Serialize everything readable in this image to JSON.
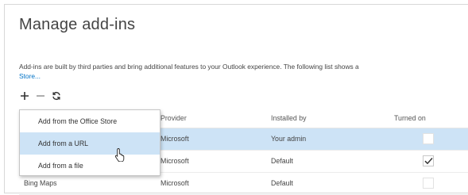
{
  "page": {
    "title": "Manage add-ins",
    "description": "Add-ins are built by third parties and bring additional features to your Outlook experience. The following list shows a",
    "description_link": "Store..."
  },
  "toolbar": {
    "icons": [
      "plus-icon",
      "minus-icon",
      "refresh-icon"
    ]
  },
  "table": {
    "columns": [
      "Provider",
      "Installed by",
      "Turned on"
    ],
    "rows": [
      {
        "name": "",
        "provider": "Microsoft",
        "installed_by": "Your admin",
        "turned_on": false,
        "selected": true
      },
      {
        "name": "",
        "provider": "Microsoft",
        "installed_by": "Default",
        "turned_on": true,
        "selected": false
      },
      {
        "name": "Bing Maps",
        "provider": "Microsoft",
        "installed_by": "Default",
        "turned_on": false,
        "selected": false
      }
    ]
  },
  "add_menu": {
    "items": [
      "Add from the Office Store",
      "Add from a URL",
      "Add from a file"
    ],
    "hovered_index": 1
  },
  "colors": {
    "accent": "#0072c6",
    "selection": "#cde3f6"
  }
}
